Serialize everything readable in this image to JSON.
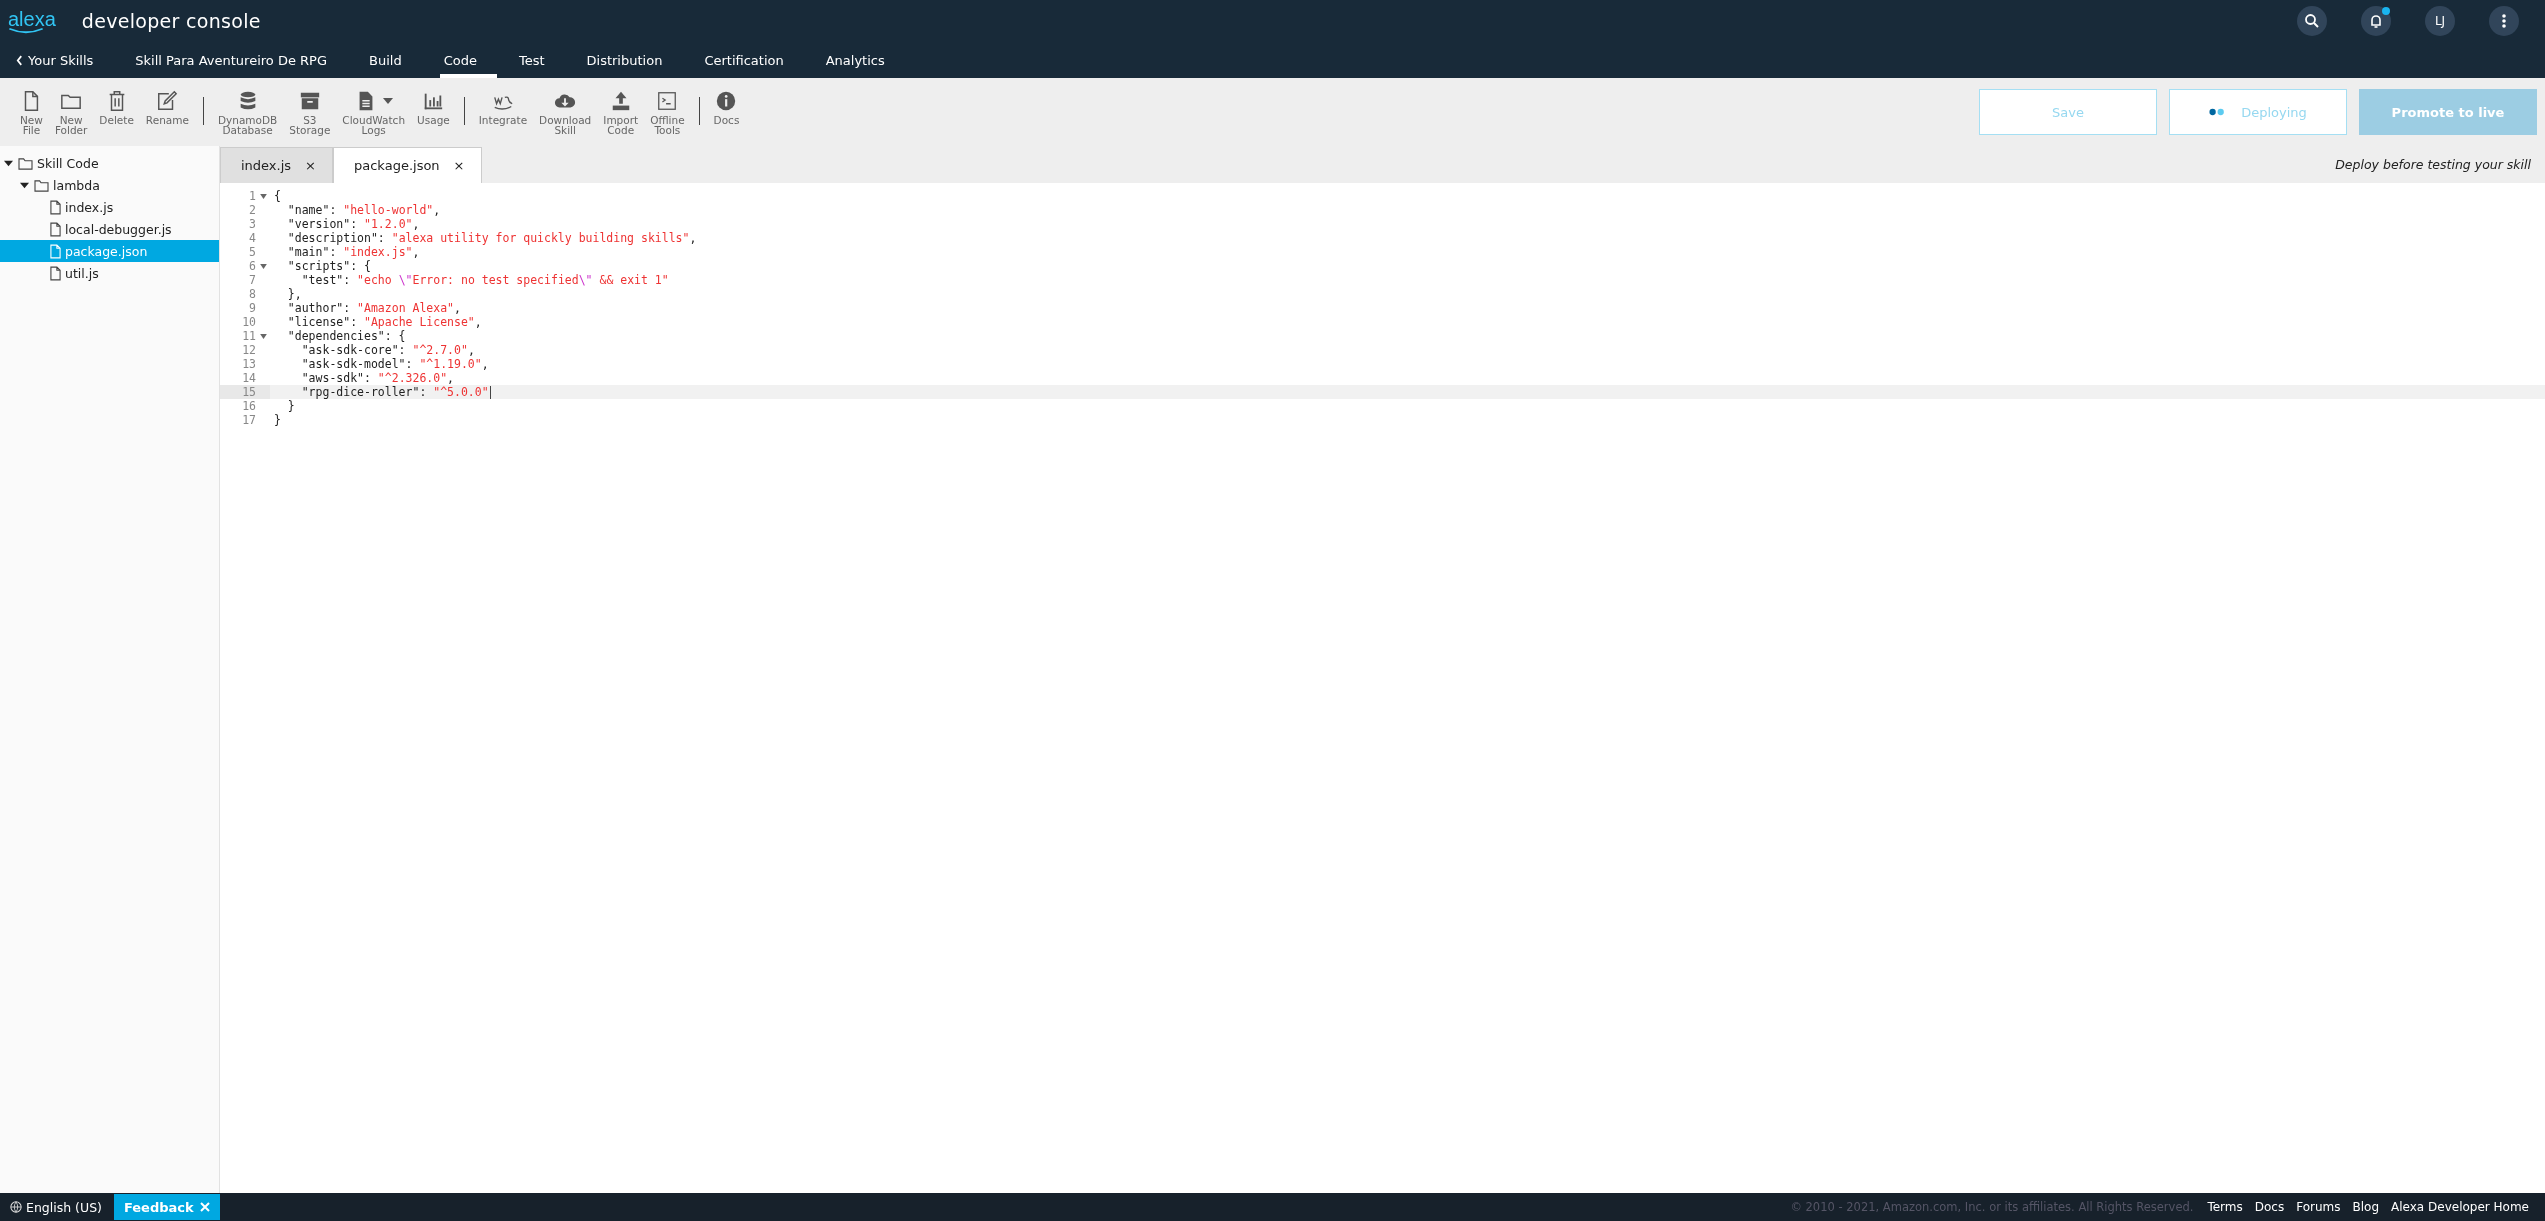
{
  "header": {
    "logo": "alexa",
    "title": "developer console",
    "notification": true,
    "avatar": "LJ"
  },
  "nav": [
    {
      "label": "Your Skills",
      "kind": "back",
      "selected": false
    },
    {
      "label": "Skill Para Aventureiro De RPG",
      "kind": "link",
      "selected": false
    },
    {
      "label": "Build",
      "kind": "link",
      "selected": false
    },
    {
      "label": "Code",
      "kind": "link",
      "selected": true
    },
    {
      "label": "Test",
      "kind": "link",
      "selected": false
    },
    {
      "label": "Distribution",
      "kind": "link",
      "selected": false
    },
    {
      "label": "Certification",
      "kind": "link",
      "selected": false
    },
    {
      "label": "Analytics",
      "kind": "link",
      "selected": false
    }
  ],
  "toolbar": [
    [
      {
        "label": "New\nFile",
        "kind": "file",
        "dropdown": false
      },
      {
        "label": "New\nFolder",
        "kind": "folder",
        "dropdown": false
      },
      {
        "label": "Delete",
        "kind": "trash",
        "dropdown": false
      },
      {
        "label": "Rename",
        "kind": "pencil",
        "dropdown": false
      }
    ],
    [
      {
        "label": "DynamoDB\nDatabase",
        "kind": "database",
        "dropdown": false
      },
      {
        "label": "S3\nStorage",
        "kind": "archive",
        "dropdown": false
      },
      {
        "label": "CloudWatch\nLogs",
        "kind": "document",
        "dropdown": true
      },
      {
        "label": "Usage",
        "kind": "chart",
        "dropdown": false
      }
    ],
    [
      {
        "label": "Integrate",
        "kind": "aws",
        "dropdown": false
      },
      {
        "label": "Download\nSkill",
        "kind": "cloud",
        "dropdown": false
      },
      {
        "label": "Import\nCode",
        "kind": "upload",
        "dropdown": false
      },
      {
        "label": "Offline\nTools",
        "kind": "terminal",
        "dropdown": false
      }
    ],
    [
      {
        "label": "Docs",
        "kind": "info",
        "dropdown": false
      }
    ]
  ],
  "actions": [
    {
      "label": "Save",
      "kind": "outline"
    },
    {
      "label": "Deploying",
      "kind": "progress"
    },
    {
      "label": "Promote to live",
      "kind": "filled"
    }
  ],
  "hint": "Deploy before testing your skill",
  "tree": [
    {
      "name": "Skill Code",
      "kind": "folder",
      "expanded": true,
      "selected": false,
      "children": [
        {
          "name": "lambda",
          "kind": "folder",
          "expanded": true,
          "selected": false,
          "children": [
            {
              "name": "index.js",
              "kind": "file",
              "selected": false
            },
            {
              "name": "local-debugger.js",
              "kind": "file",
              "selected": false
            },
            {
              "name": "package.json",
              "kind": "file",
              "selected": true
            },
            {
              "name": "util.js",
              "kind": "file",
              "selected": false
            }
          ]
        }
      ]
    }
  ],
  "tabs": [
    {
      "label": "index.js",
      "close": "×",
      "selected": false
    },
    {
      "label": "package.json",
      "close": "×",
      "selected": true
    }
  ],
  "code": [
    {
      "number": "1",
      "foldable": true,
      "active": false,
      "segments": [
        {
          "text": "{",
          "kind": "plain"
        }
      ]
    },
    {
      "number": "2",
      "foldable": false,
      "active": false,
      "segments": [
        {
          "text": "  \"name\": ",
          "kind": "plain"
        },
        {
          "text": "\"hello-world\"",
          "kind": "string"
        },
        {
          "text": ",",
          "kind": "plain"
        }
      ]
    },
    {
      "number": "3",
      "foldable": false,
      "active": false,
      "segments": [
        {
          "text": "  \"version\": ",
          "kind": "plain"
        },
        {
          "text": "\"1.2.0\"",
          "kind": "string"
        },
        {
          "text": ",",
          "kind": "plain"
        }
      ]
    },
    {
      "number": "4",
      "foldable": false,
      "active": false,
      "segments": [
        {
          "text": "  \"description\": ",
          "kind": "plain"
        },
        {
          "text": "\"alexa utility for quickly building skills\"",
          "kind": "string"
        },
        {
          "text": ",",
          "kind": "plain"
        }
      ]
    },
    {
      "number": "5",
      "foldable": false,
      "active": false,
      "segments": [
        {
          "text": "  \"main\": ",
          "kind": "plain"
        },
        {
          "text": "\"index.js\"",
          "kind": "string"
        },
        {
          "text": ",",
          "kind": "plain"
        }
      ]
    },
    {
      "number": "6",
      "foldable": true,
      "active": false,
      "segments": [
        {
          "text": "  \"scripts\": {",
          "kind": "plain"
        }
      ]
    },
    {
      "number": "7",
      "foldable": false,
      "active": false,
      "segments": [
        {
          "text": "    \"test\": ",
          "kind": "plain"
        },
        {
          "text": "\"echo ",
          "kind": "string"
        },
        {
          "text": "\\\"",
          "kind": "escape"
        },
        {
          "text": "Error: no test specified",
          "kind": "string"
        },
        {
          "text": "\\\"",
          "kind": "escape"
        },
        {
          "text": " && exit 1\"",
          "kind": "string"
        }
      ]
    },
    {
      "number": "8",
      "foldable": false,
      "active": false,
      "segments": [
        {
          "text": "  },",
          "kind": "plain"
        }
      ]
    },
    {
      "number": "9",
      "foldable": false,
      "active": false,
      "segments": [
        {
          "text": "  \"author\": ",
          "kind": "plain"
        },
        {
          "text": "\"Amazon Alexa\"",
          "kind": "string"
        },
        {
          "text": ",",
          "kind": "plain"
        }
      ]
    },
    {
      "number": "10",
      "foldable": false,
      "active": false,
      "segments": [
        {
          "text": "  \"license\": ",
          "kind": "plain"
        },
        {
          "text": "\"Apache License\"",
          "kind": "string"
        },
        {
          "text": ",",
          "kind": "plain"
        }
      ]
    },
    {
      "number": "11",
      "foldable": true,
      "active": false,
      "segments": [
        {
          "text": "  \"dependencies\": {",
          "kind": "plain"
        }
      ]
    },
    {
      "number": "12",
      "foldable": false,
      "active": false,
      "segments": [
        {
          "text": "    \"ask-sdk-core\": ",
          "kind": "plain"
        },
        {
          "text": "\"^2.7.0\"",
          "kind": "string"
        },
        {
          "text": ",",
          "kind": "plain"
        }
      ]
    },
    {
      "number": "13",
      "foldable": false,
      "active": false,
      "segments": [
        {
          "text": "    \"ask-sdk-model\": ",
          "kind": "plain"
        },
        {
          "text": "\"^1.19.0\"",
          "kind": "string"
        },
        {
          "text": ",",
          "kind": "plain"
        }
      ]
    },
    {
      "number": "14",
      "foldable": false,
      "active": false,
      "segments": [
        {
          "text": "    \"aws-sdk\": ",
          "kind": "plain"
        },
        {
          "text": "\"^2.326.0\"",
          "kind": "string"
        },
        {
          "text": ",",
          "kind": "plain"
        }
      ]
    },
    {
      "number": "15",
      "foldable": false,
      "active": true,
      "segments": [
        {
          "text": "    \"rpg-dice-roller\": ",
          "kind": "plain"
        },
        {
          "text": "\"^5.0.0\"",
          "kind": "string"
        }
      ]
    },
    {
      "number": "16",
      "foldable": false,
      "active": false,
      "segments": [
        {
          "text": "  }",
          "kind": "plain"
        }
      ]
    },
    {
      "number": "17",
      "foldable": false,
      "active": false,
      "segments": [
        {
          "text": "}",
          "kind": "plain"
        }
      ]
    }
  ],
  "footer": {
    "language": "English (US)",
    "feedback": "Feedback",
    "copyright": "© 2010 - 2021, Amazon.com, Inc. or its affiliates. All Rights Reserved.",
    "links": [
      "Terms",
      "Docs",
      "Forums",
      "Blog",
      "Alexa Developer Home"
    ]
  }
}
